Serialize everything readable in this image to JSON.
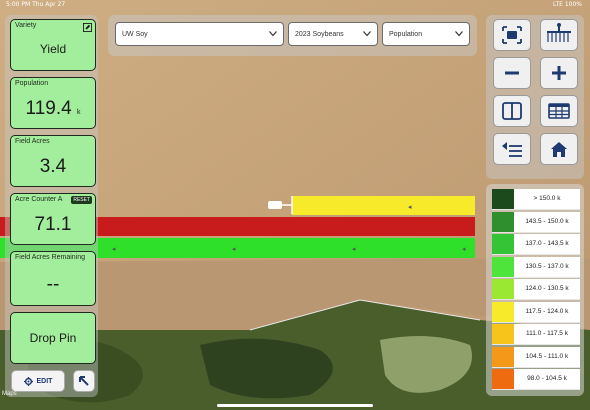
{
  "status_bar": {
    "time_date": "5:00 PM  Thu Apr 27",
    "right": "LTE  100%"
  },
  "variety_card": {
    "caption": "Variety",
    "value": "Yield"
  },
  "population_card": {
    "caption": "Population",
    "value": "119.4",
    "unit": "k"
  },
  "field_acres_card": {
    "caption": "Field Acres",
    "value": "3.4"
  },
  "acre_counter_card": {
    "caption": "Acre Counter A",
    "reset_label": "RESET",
    "value": "71.1"
  },
  "field_acres_remaining_card": {
    "caption": "Field Acres Remaining",
    "value": "--"
  },
  "drop_pin_label": "Drop Pin",
  "edit_label": "EDIT",
  "maps_attribution": "Maps",
  "selects": [
    {
      "value": "UW Soy"
    },
    {
      "value": "2023 Soybeans"
    },
    {
      "value": "Population"
    }
  ],
  "legend": [
    {
      "label": "> 150.0 k",
      "color": "#1d4a1d"
    },
    {
      "label": "143.5 - 150.0 k",
      "color": "#2f8f2f"
    },
    {
      "label": "137.0 - 143.5 k",
      "color": "#35c435"
    },
    {
      "label": "130.5 - 137.0 k",
      "color": "#4ee43c"
    },
    {
      "label": "124.0 - 130.5 k",
      "color": "#9be832"
    },
    {
      "label": "117.5 - 124.0 k",
      "color": "#f6ea2a"
    },
    {
      "label": "111.0 - 117.5 k",
      "color": "#f6c41a"
    },
    {
      "label": "104.5 - 111.0 k",
      "color": "#f39818"
    },
    {
      "label": "98.0 - 104.5 k",
      "color": "#ef6b10"
    }
  ],
  "colors": {
    "card_bg": "#a3ee9c",
    "accent": "#1e3a70"
  }
}
